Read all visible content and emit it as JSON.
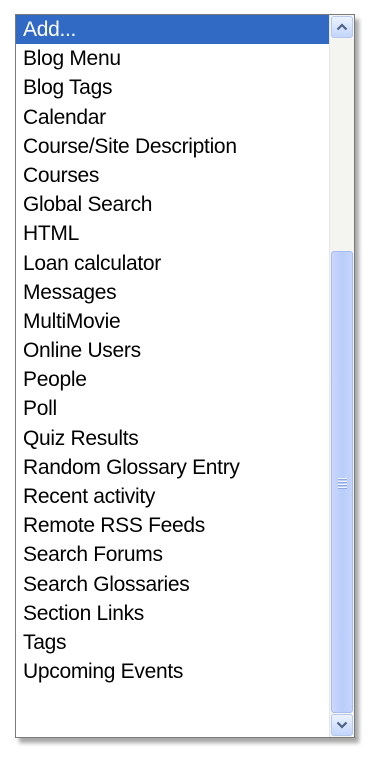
{
  "dropdown": {
    "options": [
      {
        "label": "Add...",
        "selected": true
      },
      {
        "label": "Blog Menu"
      },
      {
        "label": "Blog Tags"
      },
      {
        "label": "Calendar"
      },
      {
        "label": "Course/Site Description"
      },
      {
        "label": "Courses"
      },
      {
        "label": "Global Search"
      },
      {
        "label": "HTML"
      },
      {
        "label": "Loan calculator"
      },
      {
        "label": "Messages"
      },
      {
        "label": "MultiMovie"
      },
      {
        "label": "Online Users"
      },
      {
        "label": "People"
      },
      {
        "label": "Poll"
      },
      {
        "label": "Quiz Results"
      },
      {
        "label": "Random Glossary Entry"
      },
      {
        "label": "Recent activity"
      },
      {
        "label": "Remote RSS Feeds"
      },
      {
        "label": "Search Forums"
      },
      {
        "label": "Search Glossaries"
      },
      {
        "label": "Section Links"
      },
      {
        "label": "Tags"
      },
      {
        "label": "Upcoming Events"
      }
    ]
  },
  "scrollbar": {
    "up_icon": "chevron-up-icon",
    "down_icon": "chevron-down-icon",
    "grip_icon": "grip-icon"
  },
  "colors": {
    "selection": "#316ac5",
    "scrollbar_thumb": "#b9cdfb",
    "arrow": "#4d6185"
  }
}
